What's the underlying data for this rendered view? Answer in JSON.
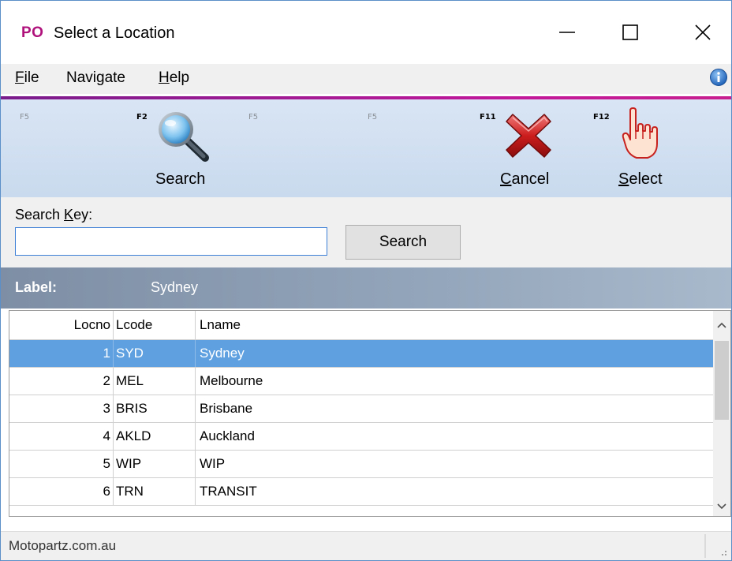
{
  "window": {
    "app_logo": "PO",
    "title": "Select a Location",
    "controls": [
      "minimize",
      "maximize",
      "close"
    ]
  },
  "menu": {
    "file": {
      "mnemonic": "F",
      "rest": "ile"
    },
    "navigate": "Navigate",
    "help": {
      "mnemonic": "H",
      "rest": "elp"
    },
    "info_icon": "info-icon"
  },
  "toolbar": {
    "slots": [
      {
        "key": "F5",
        "label": "",
        "active": false
      },
      {
        "key": "F2",
        "label": "Search",
        "icon": "magnifier-icon",
        "active": true
      },
      {
        "key": "F5",
        "label": "",
        "active": false
      },
      {
        "key": "F5",
        "label": "",
        "active": false
      },
      {
        "key": "F11",
        "label_mnemonic": "C",
        "label_rest": "ancel",
        "icon": "red-x-icon",
        "active": true
      },
      {
        "key": "F12",
        "label_mnemonic": "S",
        "label_rest": "elect",
        "icon": "pointing-hand-icon",
        "active": true
      }
    ]
  },
  "search": {
    "key_label_pre": "Search ",
    "key_label_mnemonic": "K",
    "key_label_post": "ey:",
    "value": "",
    "button": "Search"
  },
  "label_strip": {
    "key": "Label:",
    "value": "Sydney"
  },
  "grid": {
    "columns": [
      "Locno",
      "Lcode",
      "Lname"
    ],
    "rows": [
      {
        "locno": "1",
        "lcode": "SYD",
        "lname": "Sydney",
        "selected": true
      },
      {
        "locno": "2",
        "lcode": "MEL",
        "lname": "Melbourne",
        "selected": false
      },
      {
        "locno": "3",
        "lcode": "BRIS",
        "lname": "Brisbane",
        "selected": false
      },
      {
        "locno": "4",
        "lcode": "AKLD",
        "lname": "Auckland",
        "selected": false
      },
      {
        "locno": "5",
        "lcode": "WIP",
        "lname": "WIP",
        "selected": false
      },
      {
        "locno": "6",
        "lcode": "TRN",
        "lname": "TRANSIT",
        "selected": false
      }
    ]
  },
  "status": {
    "text": "Motopartz.com.au"
  },
  "colors": {
    "logo": "#b0127c",
    "accent": "#c2189a",
    "selection": "#5ea0e0",
    "toolbar_bg": "#d9e5f4",
    "label_strip": "#94a6bb"
  }
}
